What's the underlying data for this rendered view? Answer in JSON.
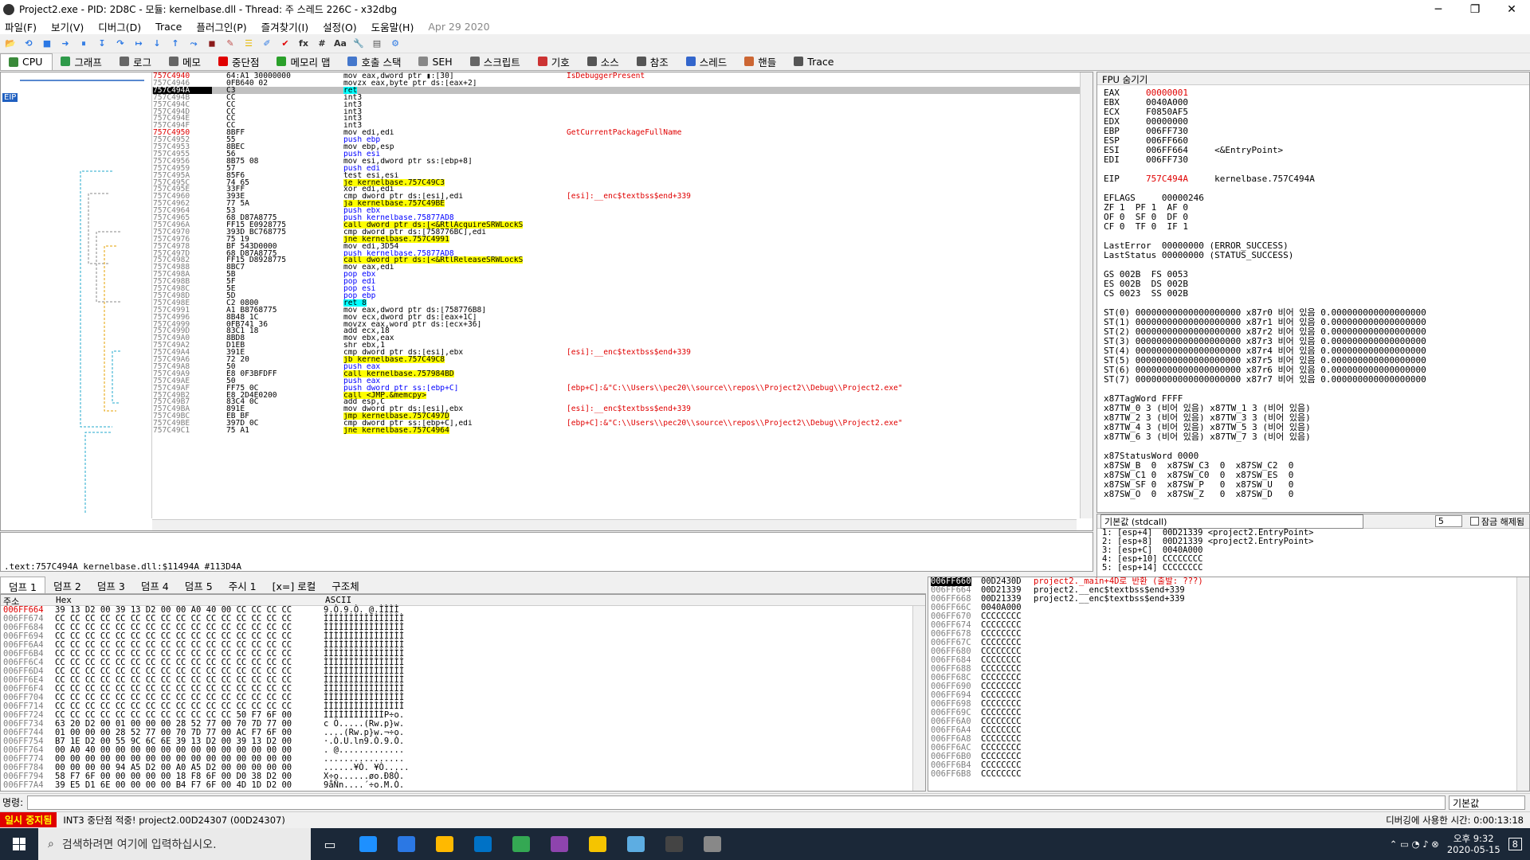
{
  "window": {
    "title": "Project2.exe - PID: 2D8C - 모듈: kernelbase.dll - Thread: 주 스레드 226C - x32dbg",
    "minimize": "─",
    "maximize": "❐",
    "close": "✕"
  },
  "menu": [
    "파일(F)",
    "보기(V)",
    "디버그(D)",
    "Trace",
    "플러그인(P)",
    "즐겨찾기(I)",
    "설정(O)",
    "도움말(H)"
  ],
  "menu_date": "Apr 29 2020",
  "toolbar": [
    "📂",
    "⟲",
    "■",
    "➜",
    "⏸",
    "↧",
    "↷",
    "↦",
    "↓",
    "↑",
    "⤳",
    "◼",
    "✎",
    "☰",
    "✐",
    "✔",
    "fx",
    "#",
    "Aa",
    "🔧",
    "▤",
    "⚙"
  ],
  "tabs": [
    {
      "label": "CPU",
      "color": "#3a8a3a"
    },
    {
      "label": "그래프",
      "color": "#2e9a4a"
    },
    {
      "label": "로그",
      "color": "#666"
    },
    {
      "label": "메모",
      "color": "#666"
    },
    {
      "label": "중단점",
      "color": "#e00000"
    },
    {
      "label": "메모리 맵",
      "color": "#2aa02a"
    },
    {
      "label": "호출 스택",
      "color": "#4477cc"
    },
    {
      "label": "SEH",
      "color": "#888"
    },
    {
      "label": "스크립트",
      "color": "#666"
    },
    {
      "label": "기호",
      "color": "#cc3333"
    },
    {
      "label": "소스",
      "color": "#555"
    },
    {
      "label": "참조",
      "color": "#555"
    },
    {
      "label": "스레드",
      "color": "#3366cc"
    },
    {
      "label": "핸들",
      "color": "#cc6633"
    },
    {
      "label": "Trace",
      "color": "#555"
    }
  ],
  "eip_label": "EIP",
  "disasm": [
    {
      "addr": "757C4940",
      "bytes": "64:A1 30000000",
      "instr": "mov eax,dword ptr ▮:[30]",
      "comment": "IsDebuggerPresent",
      "red": true
    },
    {
      "addr": "757C4946",
      "bytes": "0FB640 02",
      "instr": "movzx eax,byte ptr ds:[eax+2]",
      "comment": ""
    },
    {
      "addr": "757C494A",
      "bytes": "C3",
      "instr": "ret",
      "comment": "",
      "sel": true
    },
    {
      "addr": "757C494B",
      "bytes": "CC",
      "instr": "int3",
      "comment": ""
    },
    {
      "addr": "757C494C",
      "bytes": "CC",
      "instr": "int3",
      "comment": ""
    },
    {
      "addr": "757C494D",
      "bytes": "CC",
      "instr": "int3",
      "comment": ""
    },
    {
      "addr": "757C494E",
      "bytes": "CC",
      "instr": "int3",
      "comment": ""
    },
    {
      "addr": "757C494F",
      "bytes": "CC",
      "instr": "int3",
      "comment": ""
    },
    {
      "addr": "757C4950",
      "bytes": "8BFF",
      "instr": "mov edi,edi",
      "comment": "GetCurrentPackageFullName",
      "red": true
    },
    {
      "addr": "757C4952",
      "bytes": "55",
      "instr": "push ebp",
      "comment": ""
    },
    {
      "addr": "757C4953",
      "bytes": "8BEC",
      "instr": "mov ebp,esp",
      "comment": ""
    },
    {
      "addr": "757C4955",
      "bytes": "56",
      "instr": "push esi",
      "comment": ""
    },
    {
      "addr": "757C4956",
      "bytes": "8B75 08",
      "instr": "mov esi,dword ptr ss:[ebp+8]",
      "comment": ""
    },
    {
      "addr": "757C4959",
      "bytes": "57",
      "instr": "push edi",
      "comment": ""
    },
    {
      "addr": "757C495A",
      "bytes": "85F6",
      "instr": "test esi,esi",
      "comment": ""
    },
    {
      "addr": "757C495C",
      "bytes": "74 65",
      "instr": "je kernelbase.757C49C3",
      "comment": ""
    },
    {
      "addr": "757C495E",
      "bytes": "33FF",
      "instr": "xor edi,edi",
      "comment": ""
    },
    {
      "addr": "757C4960",
      "bytes": "393E",
      "instr": "cmp dword ptr ds:[esi],edi",
      "comment": "[esi]:__enc$textbss$end+339"
    },
    {
      "addr": "757C4962",
      "bytes": "77 5A",
      "instr": "ja kernelbase.757C49BE",
      "comment": ""
    },
    {
      "addr": "757C4964",
      "bytes": "53",
      "instr": "push ebx",
      "comment": ""
    },
    {
      "addr": "757C4965",
      "bytes": "68 D87A8775",
      "instr": "push kernelbase.75877AD8",
      "comment": ""
    },
    {
      "addr": "757C496A",
      "bytes": "FF15 E0928775",
      "instr": "call dword ptr ds:[<&RtlAcquireSRWLockS",
      "comment": ""
    },
    {
      "addr": "757C4970",
      "bytes": "393D BC768775",
      "instr": "cmp dword ptr ds:[758776BC],edi",
      "comment": ""
    },
    {
      "addr": "757C4976",
      "bytes": "75 19",
      "instr": "jne kernelbase.757C4991",
      "comment": ""
    },
    {
      "addr": "757C4978",
      "bytes": "BF 543D0000",
      "instr": "mov edi,3D54",
      "comment": ""
    },
    {
      "addr": "757C497D",
      "bytes": "68 D87A8775",
      "instr": "push kernelbase.75877AD8",
      "comment": ""
    },
    {
      "addr": "757C4982",
      "bytes": "FF15 D8928775",
      "instr": "call dword ptr ds:[<&RtlReleaseSRWLockS",
      "comment": ""
    },
    {
      "addr": "757C4988",
      "bytes": "8BC7",
      "instr": "mov eax,edi",
      "comment": ""
    },
    {
      "addr": "757C498A",
      "bytes": "5B",
      "instr": "pop ebx",
      "comment": ""
    },
    {
      "addr": "757C498B",
      "bytes": "5F",
      "instr": "pop edi",
      "comment": ""
    },
    {
      "addr": "757C498C",
      "bytes": "5E",
      "instr": "pop esi",
      "comment": ""
    },
    {
      "addr": "757C498D",
      "bytes": "5D",
      "instr": "pop ebp",
      "comment": ""
    },
    {
      "addr": "757C498E",
      "bytes": "C2 0800",
      "instr": "ret 8",
      "comment": ""
    },
    {
      "addr": "757C4991",
      "bytes": "A1 B8768775",
      "instr": "mov eax,dword ptr ds:[758776B8]",
      "comment": ""
    },
    {
      "addr": "757C4996",
      "bytes": "8B48 1C",
      "instr": "mov ecx,dword ptr ds:[eax+1C]",
      "comment": ""
    },
    {
      "addr": "757C4999",
      "bytes": "0FB741 36",
      "instr": "movzx eax,word ptr ds:[ecx+36]",
      "comment": ""
    },
    {
      "addr": "757C499D",
      "bytes": "83C1 18",
      "instr": "add ecx,18",
      "comment": ""
    },
    {
      "addr": "757C49A0",
      "bytes": "8BD8",
      "instr": "mov ebx,eax",
      "comment": ""
    },
    {
      "addr": "757C49A2",
      "bytes": "D1EB",
      "instr": "shr ebx,1",
      "comment": ""
    },
    {
      "addr": "757C49A4",
      "bytes": "391E",
      "instr": "cmp dword ptr ds:[esi],ebx",
      "comment": "[esi]:__enc$textbss$end+339"
    },
    {
      "addr": "757C49A6",
      "bytes": "72 20",
      "instr": "jb kernelbase.757C49C8",
      "comment": ""
    },
    {
      "addr": "757C49A8",
      "bytes": "50",
      "instr": "push eax",
      "comment": ""
    },
    {
      "addr": "757C49A9",
      "bytes": "E8 0F3BFDFF",
      "instr": "call kernelbase.757984BD",
      "comment": ""
    },
    {
      "addr": "757C49AE",
      "bytes": "50",
      "instr": "push eax",
      "comment": ""
    },
    {
      "addr": "757C49AF",
      "bytes": "FF75 0C",
      "instr": "push dword ptr ss:[ebp+C]",
      "comment": "[ebp+C]:&\"C:\\\\Users\\\\pec20\\\\source\\\\repos\\\\Project2\\\\Debug\\\\Project2.exe\""
    },
    {
      "addr": "757C49B2",
      "bytes": "E8 2D4E0200",
      "instr": "call <JMP.&memcpy>",
      "comment": ""
    },
    {
      "addr": "757C49B7",
      "bytes": "83C4 0C",
      "instr": "add esp,C",
      "comment": ""
    },
    {
      "addr": "757C49BA",
      "bytes": "891E",
      "instr": "mov dword ptr ds:[esi],ebx",
      "comment": "[esi]:__enc$textbss$end+339"
    },
    {
      "addr": "757C49BC",
      "bytes": "EB BF",
      "instr": "jmp kernelbase.757C497D",
      "comment": ""
    },
    {
      "addr": "757C49BE",
      "bytes": "397D 0C",
      "instr": "cmp dword ptr ss:[ebp+C],edi",
      "comment": "[ebp+C]:&\"C:\\\\Users\\\\pec20\\\\source\\\\repos\\\\Project2\\\\Debug\\\\Project2.exe\""
    },
    {
      "addr": "757C49C1",
      "bytes": "75 A1",
      "instr": "jne kernelbase.757C4964",
      "comment": ""
    }
  ],
  "info_line": ".text:757C494A kernelbase.dll:$11494A #113D4A",
  "registers": {
    "header": "FPU 숨기기",
    "lines": [
      {
        "t": "EAX     ",
        "v": "00000001",
        "c": "",
        "red": true
      },
      {
        "t": "EBX     ",
        "v": "0040A000",
        "c": ""
      },
      {
        "t": "ECX     ",
        "v": "F0850AF5",
        "c": ""
      },
      {
        "t": "EDX     ",
        "v": "00000000",
        "c": ""
      },
      {
        "t": "EBP     ",
        "v": "006FF730",
        "c": ""
      },
      {
        "t": "ESP     ",
        "v": "006FF660",
        "c": ""
      },
      {
        "t": "ESI     ",
        "v": "006FF664",
        "c": "     <&EntryPoint>"
      },
      {
        "t": "EDI     ",
        "v": "006FF730",
        "c": ""
      },
      {
        "t": "",
        "v": "",
        "c": ""
      },
      {
        "t": "EIP     ",
        "v": "757C494A",
        "c": "     kernelbase.757C494A",
        "red": true
      },
      {
        "t": "",
        "v": "",
        "c": ""
      },
      {
        "t": "EFLAGS     ",
        "v": "00000246",
        "c": ""
      },
      {
        "t": "ZF 1  PF 1  AF 0",
        "v": "",
        "c": ""
      },
      {
        "t": "OF 0  SF 0  DF 0",
        "v": "",
        "c": ""
      },
      {
        "t": "CF 0  TF 0  IF 1",
        "v": "",
        "c": ""
      },
      {
        "t": "",
        "v": "",
        "c": ""
      },
      {
        "t": "LastError  00000000 (ERROR_SUCCESS)",
        "v": "",
        "c": ""
      },
      {
        "t": "LastStatus 00000000 (STATUS_SUCCESS)",
        "v": "",
        "c": ""
      },
      {
        "t": "",
        "v": "",
        "c": ""
      },
      {
        "t": "GS 002B  FS 0053",
        "v": "",
        "c": ""
      },
      {
        "t": "ES 002B  DS 002B",
        "v": "",
        "c": ""
      },
      {
        "t": "CS 0023  SS 002B",
        "v": "",
        "c": ""
      },
      {
        "t": "",
        "v": "",
        "c": ""
      },
      {
        "t": "ST(0) 00000000000000000000 x87r0 비어 있음 0.000000000000000000",
        "v": "",
        "c": ""
      },
      {
        "t": "ST(1) 00000000000000000000 x87r1 비어 있음 0.000000000000000000",
        "v": "",
        "c": ""
      },
      {
        "t": "ST(2) 00000000000000000000 x87r2 비어 있음 0.000000000000000000",
        "v": "",
        "c": ""
      },
      {
        "t": "ST(3) 00000000000000000000 x87r3 비어 있음 0.000000000000000000",
        "v": "",
        "c": ""
      },
      {
        "t": "ST(4) 00000000000000000000 x87r4 비어 있음 0.000000000000000000",
        "v": "",
        "c": ""
      },
      {
        "t": "ST(5) 00000000000000000000 x87r5 비어 있음 0.000000000000000000",
        "v": "",
        "c": ""
      },
      {
        "t": "ST(6) 00000000000000000000 x87r6 비어 있음 0.000000000000000000",
        "v": "",
        "c": ""
      },
      {
        "t": "ST(7) 00000000000000000000 x87r7 비어 있음 0.000000000000000000",
        "v": "",
        "c": ""
      },
      {
        "t": "",
        "v": "",
        "c": ""
      },
      {
        "t": "x87TagWord FFFF",
        "v": "",
        "c": ""
      },
      {
        "t": "x87TW_0 3 (비어 있음) x87TW_1 3 (비어 있음)",
        "v": "",
        "c": ""
      },
      {
        "t": "x87TW_2 3 (비어 있음) x87TW_3 3 (비어 있음)",
        "v": "",
        "c": ""
      },
      {
        "t": "x87TW_4 3 (비어 있음) x87TW_5 3 (비어 있음)",
        "v": "",
        "c": ""
      },
      {
        "t": "x87TW_6 3 (비어 있음) x87TW_7 3 (비어 있음)",
        "v": "",
        "c": ""
      },
      {
        "t": "",
        "v": "",
        "c": ""
      },
      {
        "t": "x87StatusWord 0000",
        "v": "",
        "c": ""
      },
      {
        "t": "x87SW_B  0  x87SW_C3  0  x87SW_C2  0",
        "v": "",
        "c": ""
      },
      {
        "t": "x87SW_C1 0  x87SW_C0  0  x87SW_ES  0",
        "v": "",
        "c": ""
      },
      {
        "t": "x87SW_SF 0  x87SW_P   0  x87SW_U   0",
        "v": "",
        "c": ""
      },
      {
        "t": "x87SW_O  0  x87SW_Z   0  x87SW_D   0",
        "v": "",
        "c": ""
      }
    ]
  },
  "callstack": {
    "conv": "기본값 (stdcall)",
    "count": "5",
    "unlock": "잠금 해제됨",
    "lines": [
      "1: [esp+4]  00D21339 <project2.EntryPoint>",
      "2: [esp+8]  00D21339 <project2.EntryPoint>",
      "3: [esp+C]  0040A000",
      "4: [esp+10] CCCCCCCC",
      "5: [esp+14] CCCCCCCC"
    ]
  },
  "dump_tabs": [
    "덤프 1",
    "덤프 2",
    "덤프 3",
    "덤프 4",
    "덤프 5",
    "주시 1",
    "[x=] 로컬",
    "구조체"
  ],
  "dump_headers": {
    "addr": "주소",
    "hex": "Hex",
    "ascii": "ASCII"
  },
  "dump": [
    {
      "a": "006FF664",
      "h": "39 13 D2 00 39 13 D2 00 00 A0 40 00 CC CC CC CC",
      "s": "9.Ò.9.Ò. @.ÌÌÌÌ"
    },
    {
      "a": "006FF674",
      "h": "CC CC CC CC CC CC CC CC CC CC CC CC CC CC CC CC",
      "s": "ÌÌÌÌÌÌÌÌÌÌÌÌÌÌÌÌ"
    },
    {
      "a": "006FF684",
      "h": "CC CC CC CC CC CC CC CC CC CC CC CC CC CC CC CC",
      "s": "ÌÌÌÌÌÌÌÌÌÌÌÌÌÌÌÌ"
    },
    {
      "a": "006FF694",
      "h": "CC CC CC CC CC CC CC CC CC CC CC CC CC CC CC CC",
      "s": "ÌÌÌÌÌÌÌÌÌÌÌÌÌÌÌÌ"
    },
    {
      "a": "006FF6A4",
      "h": "CC CC CC CC CC CC CC CC CC CC CC CC CC CC CC CC",
      "s": "ÌÌÌÌÌÌÌÌÌÌÌÌÌÌÌÌ"
    },
    {
      "a": "006FF6B4",
      "h": "CC CC CC CC CC CC CC CC CC CC CC CC CC CC CC CC",
      "s": "ÌÌÌÌÌÌÌÌÌÌÌÌÌÌÌÌ"
    },
    {
      "a": "006FF6C4",
      "h": "CC CC CC CC CC CC CC CC CC CC CC CC CC CC CC CC",
      "s": "ÌÌÌÌÌÌÌÌÌÌÌÌÌÌÌÌ"
    },
    {
      "a": "006FF6D4",
      "h": "CC CC CC CC CC CC CC CC CC CC CC CC CC CC CC CC",
      "s": "ÌÌÌÌÌÌÌÌÌÌÌÌÌÌÌÌ"
    },
    {
      "a": "006FF6E4",
      "h": "CC CC CC CC CC CC CC CC CC CC CC CC CC CC CC CC",
      "s": "ÌÌÌÌÌÌÌÌÌÌÌÌÌÌÌÌ"
    },
    {
      "a": "006FF6F4",
      "h": "CC CC CC CC CC CC CC CC CC CC CC CC CC CC CC CC",
      "s": "ÌÌÌÌÌÌÌÌÌÌÌÌÌÌÌÌ"
    },
    {
      "a": "006FF704",
      "h": "CC CC CC CC CC CC CC CC CC CC CC CC CC CC CC CC",
      "s": "ÌÌÌÌÌÌÌÌÌÌÌÌÌÌÌÌ"
    },
    {
      "a": "006FF714",
      "h": "CC CC CC CC CC CC CC CC CC CC CC CC CC CC CC CC",
      "s": "ÌÌÌÌÌÌÌÌÌÌÌÌÌÌÌÌ"
    },
    {
      "a": "006FF724",
      "h": "CC CC CC CC CC CC CC CC CC CC CC CC 50 F7 6F 00",
      "s": "ÌÌÌÌÌÌÌÌÌÌÌÌP÷o."
    },
    {
      "a": "006FF734",
      "h": "63 20 D2 00 01 00 00 00 28 52 77 00 70 7D 77 00",
      "s": "c Ò.....(Rw.p}w."
    },
    {
      "a": "006FF744",
      "h": "01 00 00 00 28 52 77 00 70 7D 77 00 AC F7 6F 00",
      "s": "....(Rw.p}w.¬÷o."
    },
    {
      "a": "006FF754",
      "h": "B7 1E D2 00 55 9C 6C 6E 39 13 D2 00 39 13 D2 00",
      "s": "·.Ò.U.ln9.Ò.9.Ò."
    },
    {
      "a": "006FF764",
      "h": "00 A0 40 00 00 00 00 00 00 00 00 00 00 00 00 00",
      "s": ". @............."
    },
    {
      "a": "006FF774",
      "h": "00 00 00 00 00 00 00 00 00 00 00 00 00 00 00 00",
      "s": "................"
    },
    {
      "a": "006FF784",
      "h": "00 00 00 00 94 A5 D2 00 A0 A5 D2 00 00 00 00 00",
      "s": "......¥Ò. ¥Ò....."
    },
    {
      "a": "006FF794",
      "h": "58 F7 6F 00 00 00 00 00 18 F8 6F 00 D0 38 D2 00",
      "s": "X÷o......øo.Ð8Ò."
    },
    {
      "a": "006FF7A4",
      "h": "39 E5 D1 6E 00 00 00 00 B4 F7 6F 00 4D 1D D2 00",
      "s": "9åÑn....´÷o.M.Ò."
    }
  ],
  "stack": [
    {
      "a": "006FF660",
      "v": "00D2430D",
      "c": "project2._main+4D로 반환 (출발: ???)",
      "top": true
    },
    {
      "a": "006FF664",
      "v": "00D21339",
      "c": "project2.__enc$textbss$end+339"
    },
    {
      "a": "006FF668",
      "v": "00D21339",
      "c": "project2.__enc$textbss$end+339"
    },
    {
      "a": "006FF66C",
      "v": "0040A000",
      "c": ""
    },
    {
      "a": "006FF670",
      "v": "CCCCCCCC",
      "c": ""
    },
    {
      "a": "006FF674",
      "v": "CCCCCCCC",
      "c": ""
    },
    {
      "a": "006FF678",
      "v": "CCCCCCCC",
      "c": ""
    },
    {
      "a": "006FF67C",
      "v": "CCCCCCCC",
      "c": ""
    },
    {
      "a": "006FF680",
      "v": "CCCCCCCC",
      "c": ""
    },
    {
      "a": "006FF684",
      "v": "CCCCCCCC",
      "c": ""
    },
    {
      "a": "006FF688",
      "v": "CCCCCCCC",
      "c": ""
    },
    {
      "a": "006FF68C",
      "v": "CCCCCCCC",
      "c": ""
    },
    {
      "a": "006FF690",
      "v": "CCCCCCCC",
      "c": ""
    },
    {
      "a": "006FF694",
      "v": "CCCCCCCC",
      "c": ""
    },
    {
      "a": "006FF698",
      "v": "CCCCCCCC",
      "c": ""
    },
    {
      "a": "006FF69C",
      "v": "CCCCCCCC",
      "c": ""
    },
    {
      "a": "006FF6A0",
      "v": "CCCCCCCC",
      "c": ""
    },
    {
      "a": "006FF6A4",
      "v": "CCCCCCCC",
      "c": ""
    },
    {
      "a": "006FF6A8",
      "v": "CCCCCCCC",
      "c": ""
    },
    {
      "a": "006FF6AC",
      "v": "CCCCCCCC",
      "c": ""
    },
    {
      "a": "006FF6B0",
      "v": "CCCCCCCC",
      "c": ""
    },
    {
      "a": "006FF6B4",
      "v": "CCCCCCCC",
      "c": ""
    },
    {
      "a": "006FF6B8",
      "v": "CCCCCCCC",
      "c": ""
    }
  ],
  "command": {
    "label": "명령:",
    "dropdown": "기본값"
  },
  "status": {
    "state": "일시 중지됨",
    "message": "INT3 중단점 적중! project2.00D24307 (00D24307)",
    "time": "디버깅에 사용한 시간: 0:00:13:18"
  },
  "taskbar": {
    "search_placeholder": "검색하려면 여기에 입력하십시오.",
    "apps": [
      "#1e90ff",
      "#2b78e4",
      "#ffb900",
      "#0072c6",
      "#34a853",
      "#8e44ad",
      "#f5c400",
      "#5dade2",
      "#444444",
      "#888888"
    ],
    "clock_time": "오후 9:32",
    "clock_date": "2020-05-15",
    "notif": "8"
  }
}
